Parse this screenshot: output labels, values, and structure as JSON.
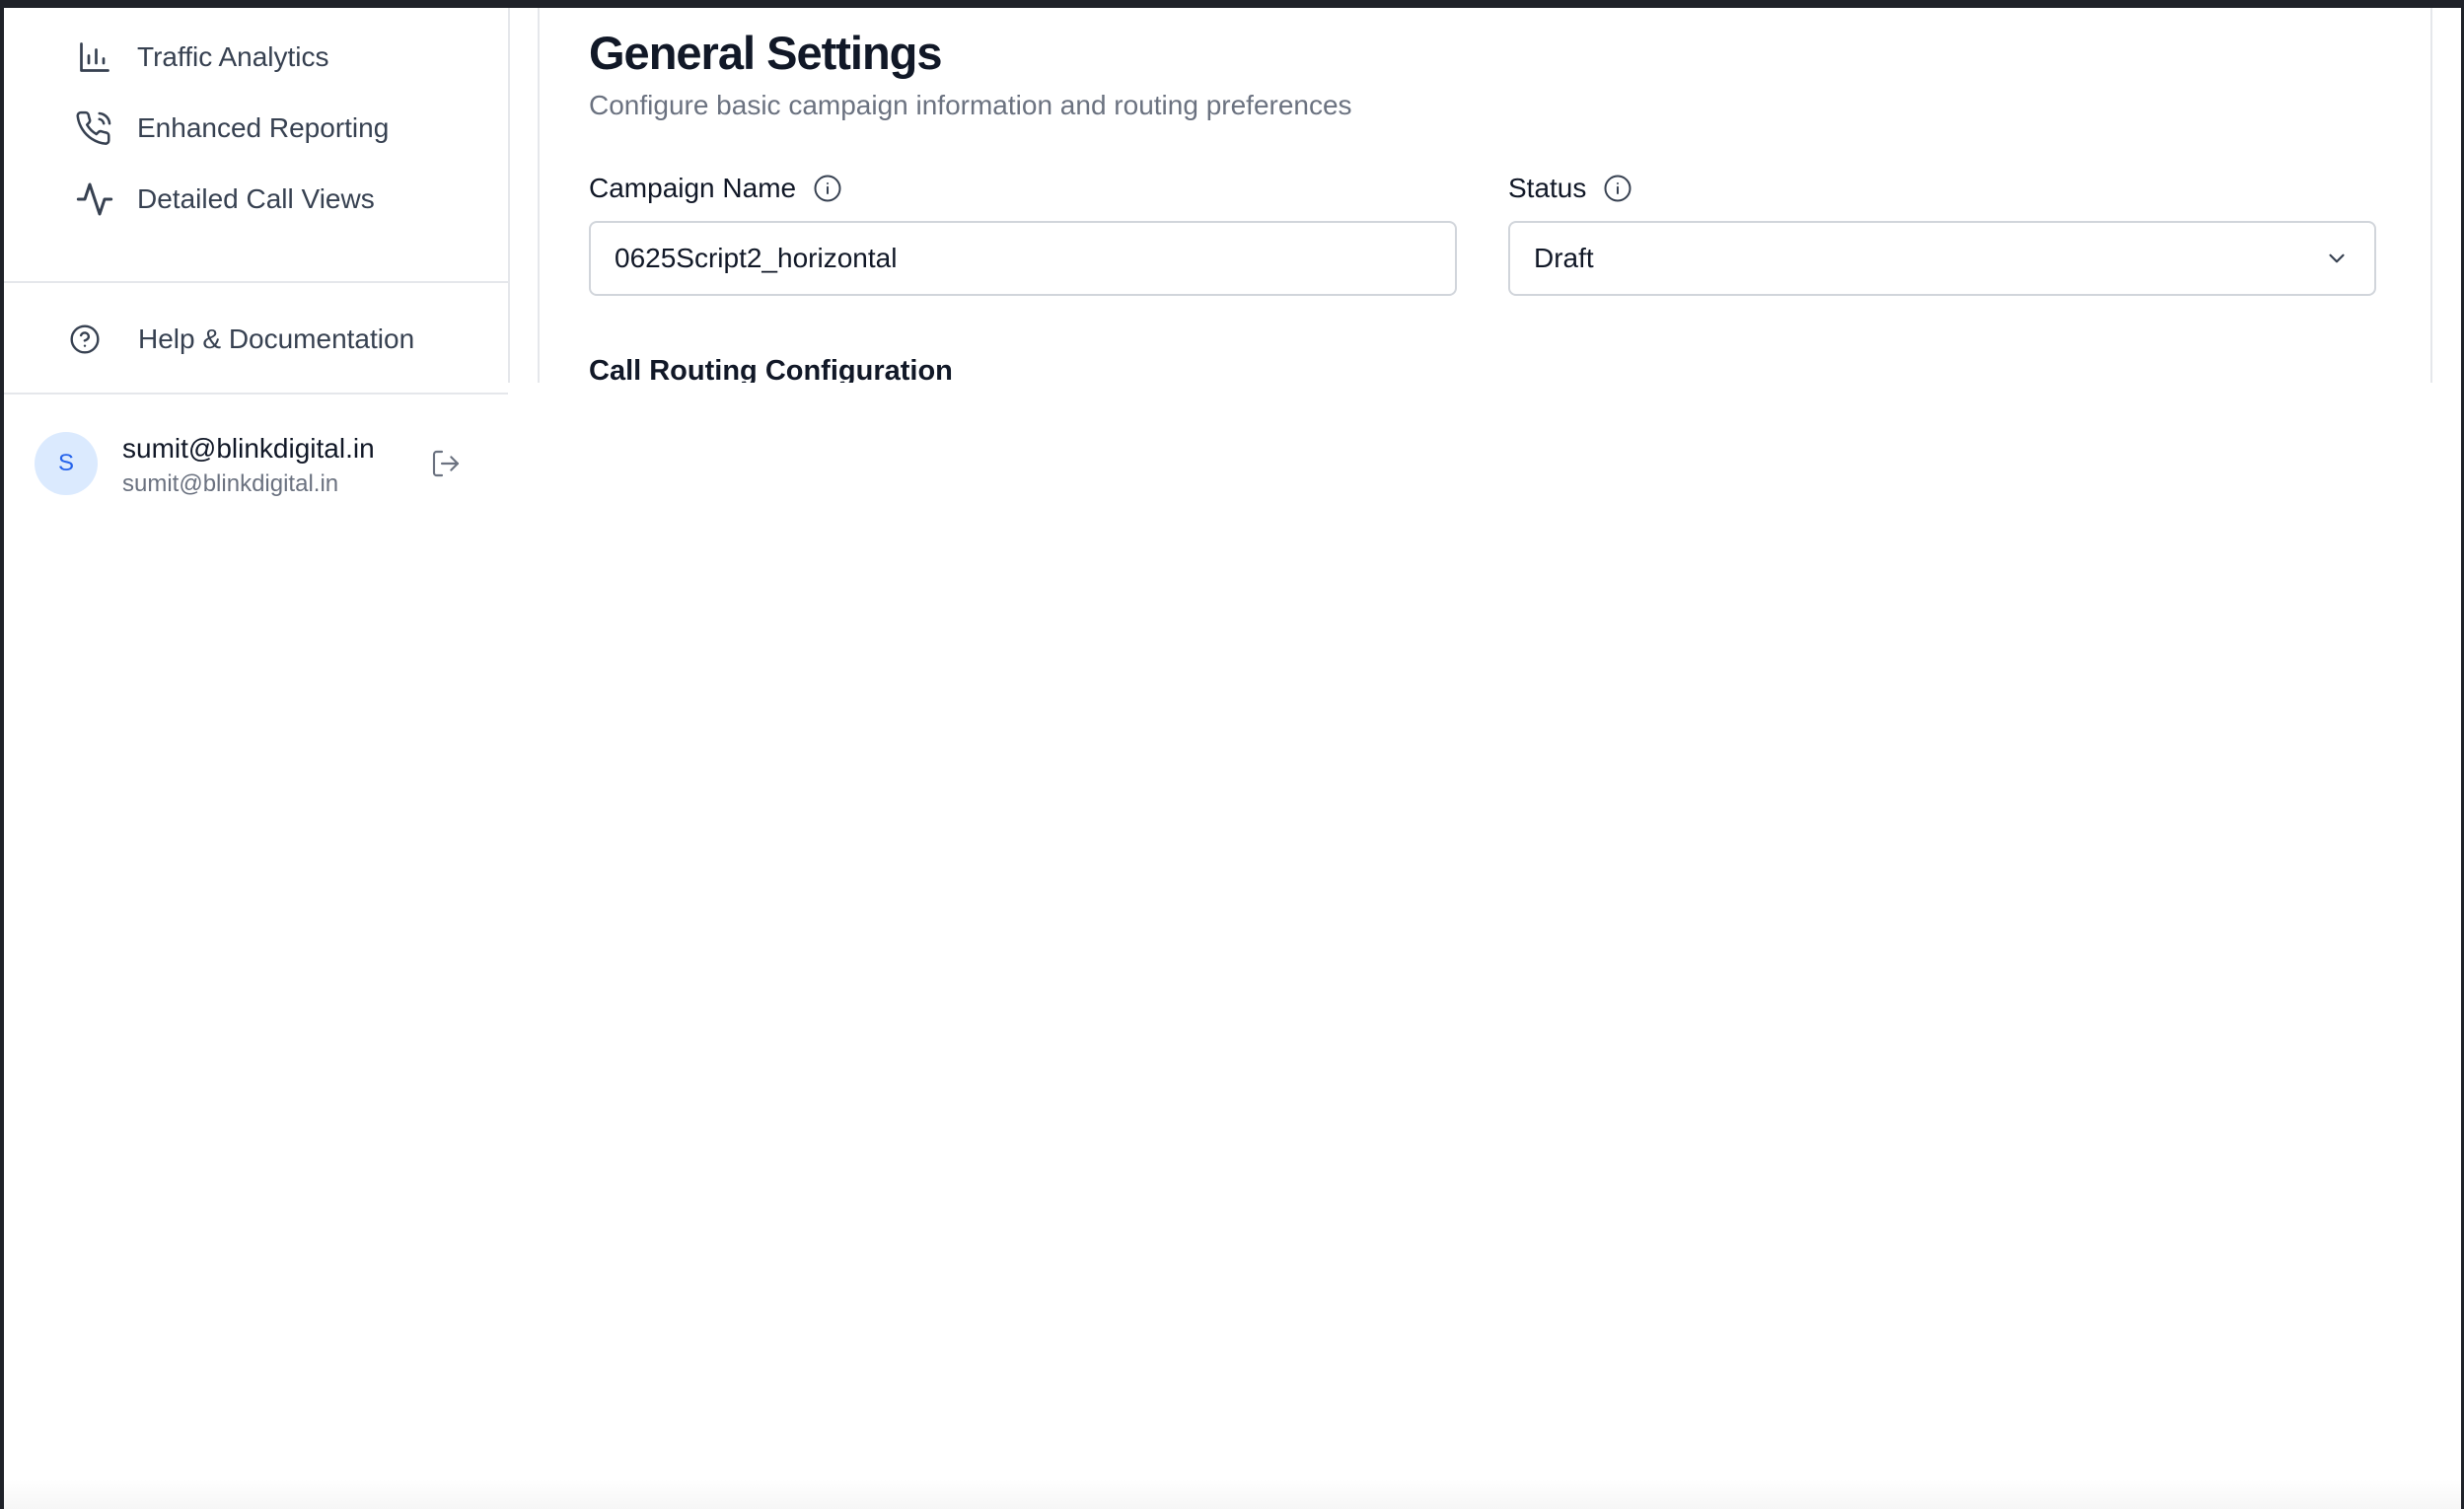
{
  "sidebar": {
    "items": [
      {
        "label": "Traffic Analytics",
        "icon": "bar-chart-icon"
      },
      {
        "label": "Enhanced Reporting",
        "icon": "phone-call-icon"
      },
      {
        "label": "Detailed Call Views",
        "icon": "activity-icon"
      }
    ],
    "help": {
      "label": "Help & Documentation",
      "icon": "help-circle-icon"
    }
  },
  "user": {
    "avatar_initial": "S",
    "name": "sumit@blinkdigital.in",
    "email": "sumit@blinkdigital.in",
    "logout_icon": "logout-icon"
  },
  "main": {
    "title": "General Settings",
    "subtitle": "Configure basic campaign information and routing preferences",
    "campaign_name": {
      "label": "Campaign Name",
      "value": "0625Script2_horizontal"
    },
    "status": {
      "label": "Status",
      "value": "Draft"
    },
    "section_heading": "Call Routing Configuration"
  },
  "colors": {
    "frame": "#1f2229",
    "text_primary": "#111827",
    "text_muted": "#6b7280",
    "avatar_bg": "#dbeafe",
    "avatar_fg": "#2563eb",
    "border": "#d1d5db"
  }
}
